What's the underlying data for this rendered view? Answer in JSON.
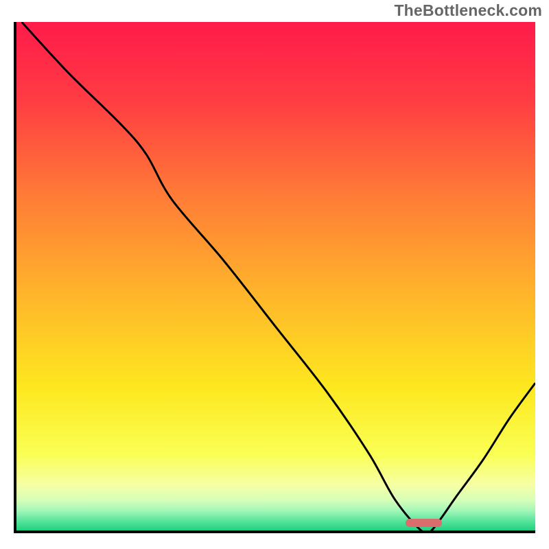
{
  "watermark": "TheBottleneck.com",
  "chart_data": {
    "type": "line",
    "title": "",
    "xlabel": "",
    "ylabel": "",
    "xlim": [
      0,
      100
    ],
    "ylim": [
      0,
      100
    ],
    "x": [
      1,
      10,
      20,
      25,
      30,
      40,
      50,
      60,
      68,
      73,
      78,
      80,
      85,
      90,
      95,
      100
    ],
    "values": [
      100,
      90,
      80,
      74,
      65,
      53,
      40,
      27,
      15,
      6,
      0,
      0,
      7,
      14,
      22,
      29
    ],
    "optimum_marker": {
      "x_start": 75,
      "x_end": 82,
      "y": 1.5
    },
    "gradient_stops": [
      {
        "pos": 0,
        "color": "#ff1b4b"
      },
      {
        "pos": 15,
        "color": "#ff3b43"
      },
      {
        "pos": 35,
        "color": "#ff7e36"
      },
      {
        "pos": 55,
        "color": "#ffb92a"
      },
      {
        "pos": 72,
        "color": "#fde81f"
      },
      {
        "pos": 85,
        "color": "#faff54"
      },
      {
        "pos": 91,
        "color": "#f6ffa4"
      },
      {
        "pos": 94,
        "color": "#d7ffb8"
      },
      {
        "pos": 96,
        "color": "#a6f7b8"
      },
      {
        "pos": 98,
        "color": "#5be69f"
      },
      {
        "pos": 100,
        "color": "#1fd17d"
      }
    ],
    "marker_color": "#d96c6c",
    "curve_color": "#000000",
    "curve_width": 3
  }
}
